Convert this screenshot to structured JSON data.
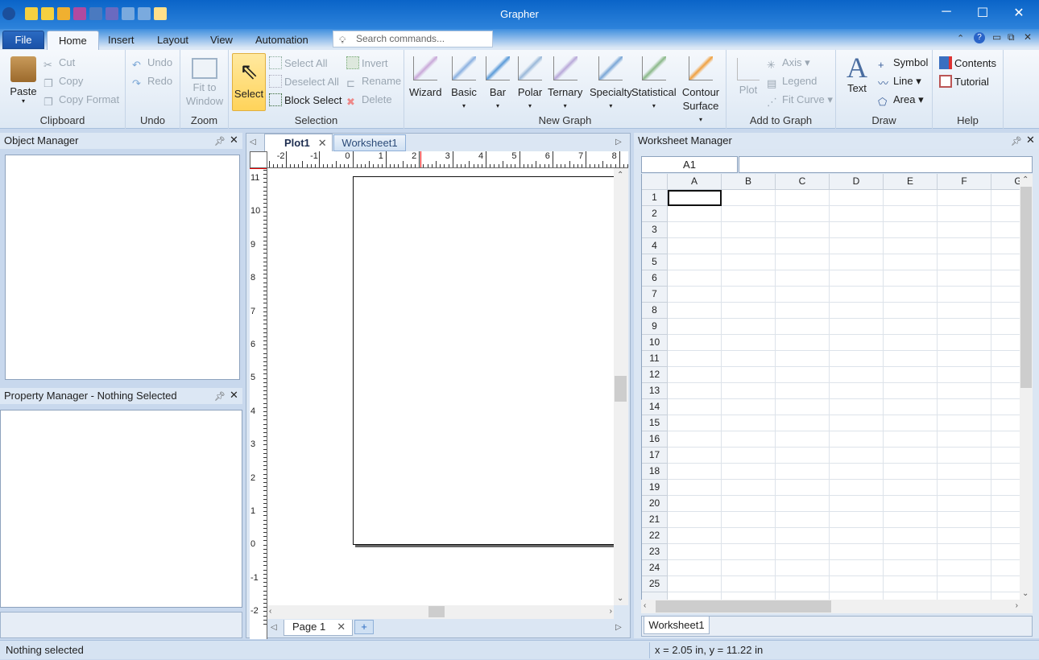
{
  "app": {
    "title": "Grapher"
  },
  "quick_access": [
    "globe-app-icon",
    "new-plot-icon",
    "new-worksheet-icon",
    "open-icon",
    "save-icon",
    "export-icon",
    "import-icon",
    "undo-icon",
    "redo-icon",
    "select-tool-icon"
  ],
  "ribbon_tabs": {
    "file": "File",
    "tabs": [
      "Home",
      "Insert",
      "Layout",
      "View",
      "Automation"
    ],
    "active": "Home"
  },
  "search": {
    "placeholder": "Search commands..."
  },
  "ribbon": {
    "clipboard": {
      "label": "Clipboard",
      "paste": "Paste",
      "cut": "Cut",
      "copy": "Copy",
      "copy_format": "Copy Format"
    },
    "undo": {
      "label": "Undo",
      "undo": "Undo",
      "redo": "Redo"
    },
    "zoom": {
      "label": "Zoom",
      "fit": "Fit to Window"
    },
    "selection": {
      "label": "Selection",
      "select": "Select",
      "select_all": "Select All",
      "deselect_all": "Deselect All",
      "block_select": "Block Select",
      "invert": "Invert",
      "rename": "Rename",
      "delete": "Delete"
    },
    "new_graph": {
      "label": "New Graph",
      "items": [
        "Wizard",
        "Basic",
        "Bar",
        "Polar",
        "Ternary",
        "Specialty",
        "Statistical",
        "Contour Surface"
      ]
    },
    "add_to_graph": {
      "label": "Add to Graph",
      "plot": "Plot",
      "axis": "Axis",
      "legend": "Legend",
      "fit_curve": "Fit Curve"
    },
    "draw": {
      "label": "Draw",
      "text": "Text",
      "symbol": "Symbol",
      "line": "Line",
      "area": "Area"
    },
    "help": {
      "label": "Help",
      "contents": "Contents",
      "tutorial": "Tutorial"
    }
  },
  "object_manager": {
    "title": "Object Manager"
  },
  "property_manager": {
    "title": "Property Manager - Nothing Selected"
  },
  "doc_tabs": [
    "Plot1",
    "Worksheet1"
  ],
  "active_doc": "Plot1",
  "rulers": {
    "horizontal": [
      "-2",
      "-1",
      "0",
      "1",
      "2",
      "3",
      "4",
      "5",
      "6",
      "7",
      "8"
    ],
    "vertical": [
      "11",
      "10",
      "9",
      "8",
      "7",
      "6",
      "5",
      "4",
      "3",
      "2",
      "1",
      "0",
      "-1",
      "-2"
    ]
  },
  "page_tabs": {
    "page": "Page 1",
    "add": "+"
  },
  "worksheet_manager": {
    "title": "Worksheet Manager",
    "cell_ref": "A1",
    "formula": "",
    "columns": [
      "A",
      "B",
      "C",
      "D",
      "E",
      "F",
      "G"
    ],
    "rows": [
      "1",
      "2",
      "3",
      "4",
      "5",
      "6",
      "7",
      "8",
      "9",
      "10",
      "11",
      "12",
      "13",
      "14",
      "15",
      "16",
      "17",
      "18",
      "19",
      "20",
      "21",
      "22",
      "23",
      "24",
      "25"
    ],
    "sheet_tab": "Worksheet1"
  },
  "status": {
    "left": "Nothing selected",
    "coords": "x = 2.05 in, y = 11.22 in"
  }
}
